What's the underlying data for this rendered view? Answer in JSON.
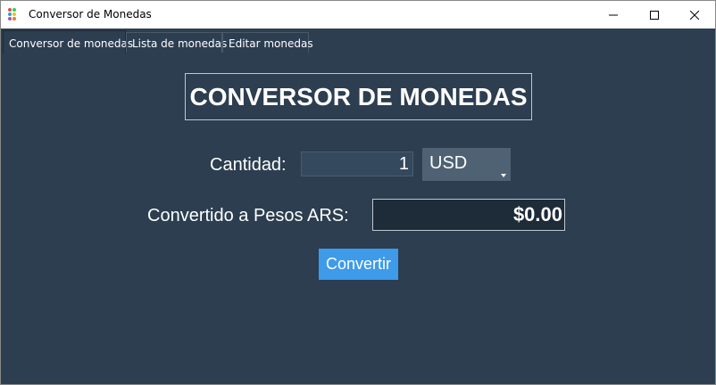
{
  "window": {
    "title": "Conversor de Monedas",
    "controls": [
      "minimize",
      "maximize",
      "close"
    ]
  },
  "tabs": [
    {
      "label": "Conversor de monedas",
      "active": true
    },
    {
      "label": "Lista de monedas",
      "active": false
    },
    {
      "label": "Editar monedas",
      "active": false
    }
  ],
  "main": {
    "heading": "CONVERSOR DE MONEDAS",
    "quantity_label": "Cantidad:",
    "quantity_value": "1",
    "currency_selected": "USD",
    "converted_label": "Convertido a Pesos ARS:",
    "converted_value": "$0.00",
    "convert_button": "Convertir"
  },
  "colors": {
    "background": "#2c3e50",
    "button_accent": "#3d9be9",
    "input_background": "#34495e",
    "select_background": "#4f6274",
    "result_background": "#1e2b38"
  }
}
